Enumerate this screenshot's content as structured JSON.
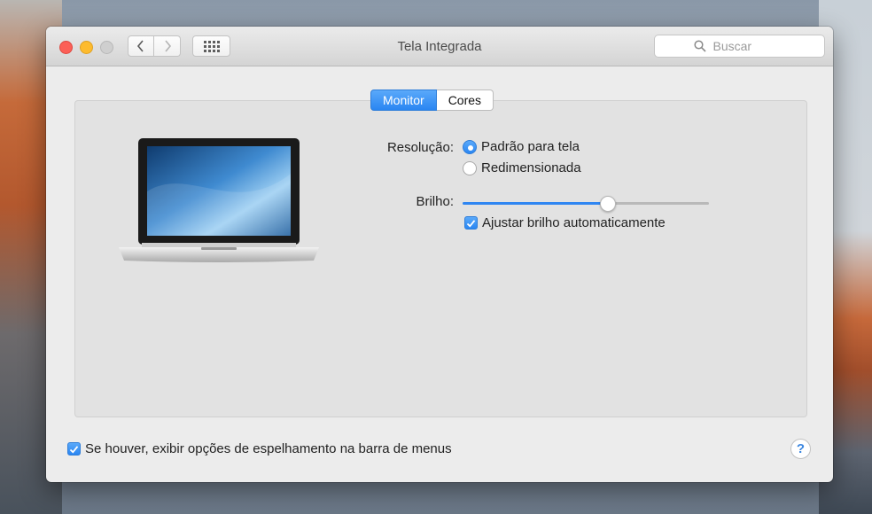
{
  "window": {
    "title": "Tela Integrada"
  },
  "toolbar": {
    "back_icon": "chevron-left-icon",
    "forward_icon": "chevron-right-icon",
    "grid_icon": "grid-icon",
    "search_placeholder": "Buscar",
    "search_icon": "search-icon"
  },
  "tabs": [
    {
      "label": "Monitor",
      "selected": true
    },
    {
      "label": "Cores",
      "selected": false
    }
  ],
  "resolution": {
    "label": "Resolução:",
    "options": [
      {
        "label": "Padrão para tela",
        "selected": true
      },
      {
        "label": "Redimensionada",
        "selected": false
      }
    ]
  },
  "brightness": {
    "label": "Brilho:",
    "value": 0.59,
    "auto_adjust_label": "Ajustar brilho automaticamente",
    "auto_adjust_checked": true
  },
  "footer": {
    "mirroring_label": "Se houver, exibir opções de espelhamento na barra de menus",
    "mirroring_checked": true,
    "help_label": "?"
  },
  "colors": {
    "accent": "#2f86f2",
    "close": "#fc5f57",
    "minimize": "#fdbb2e"
  }
}
